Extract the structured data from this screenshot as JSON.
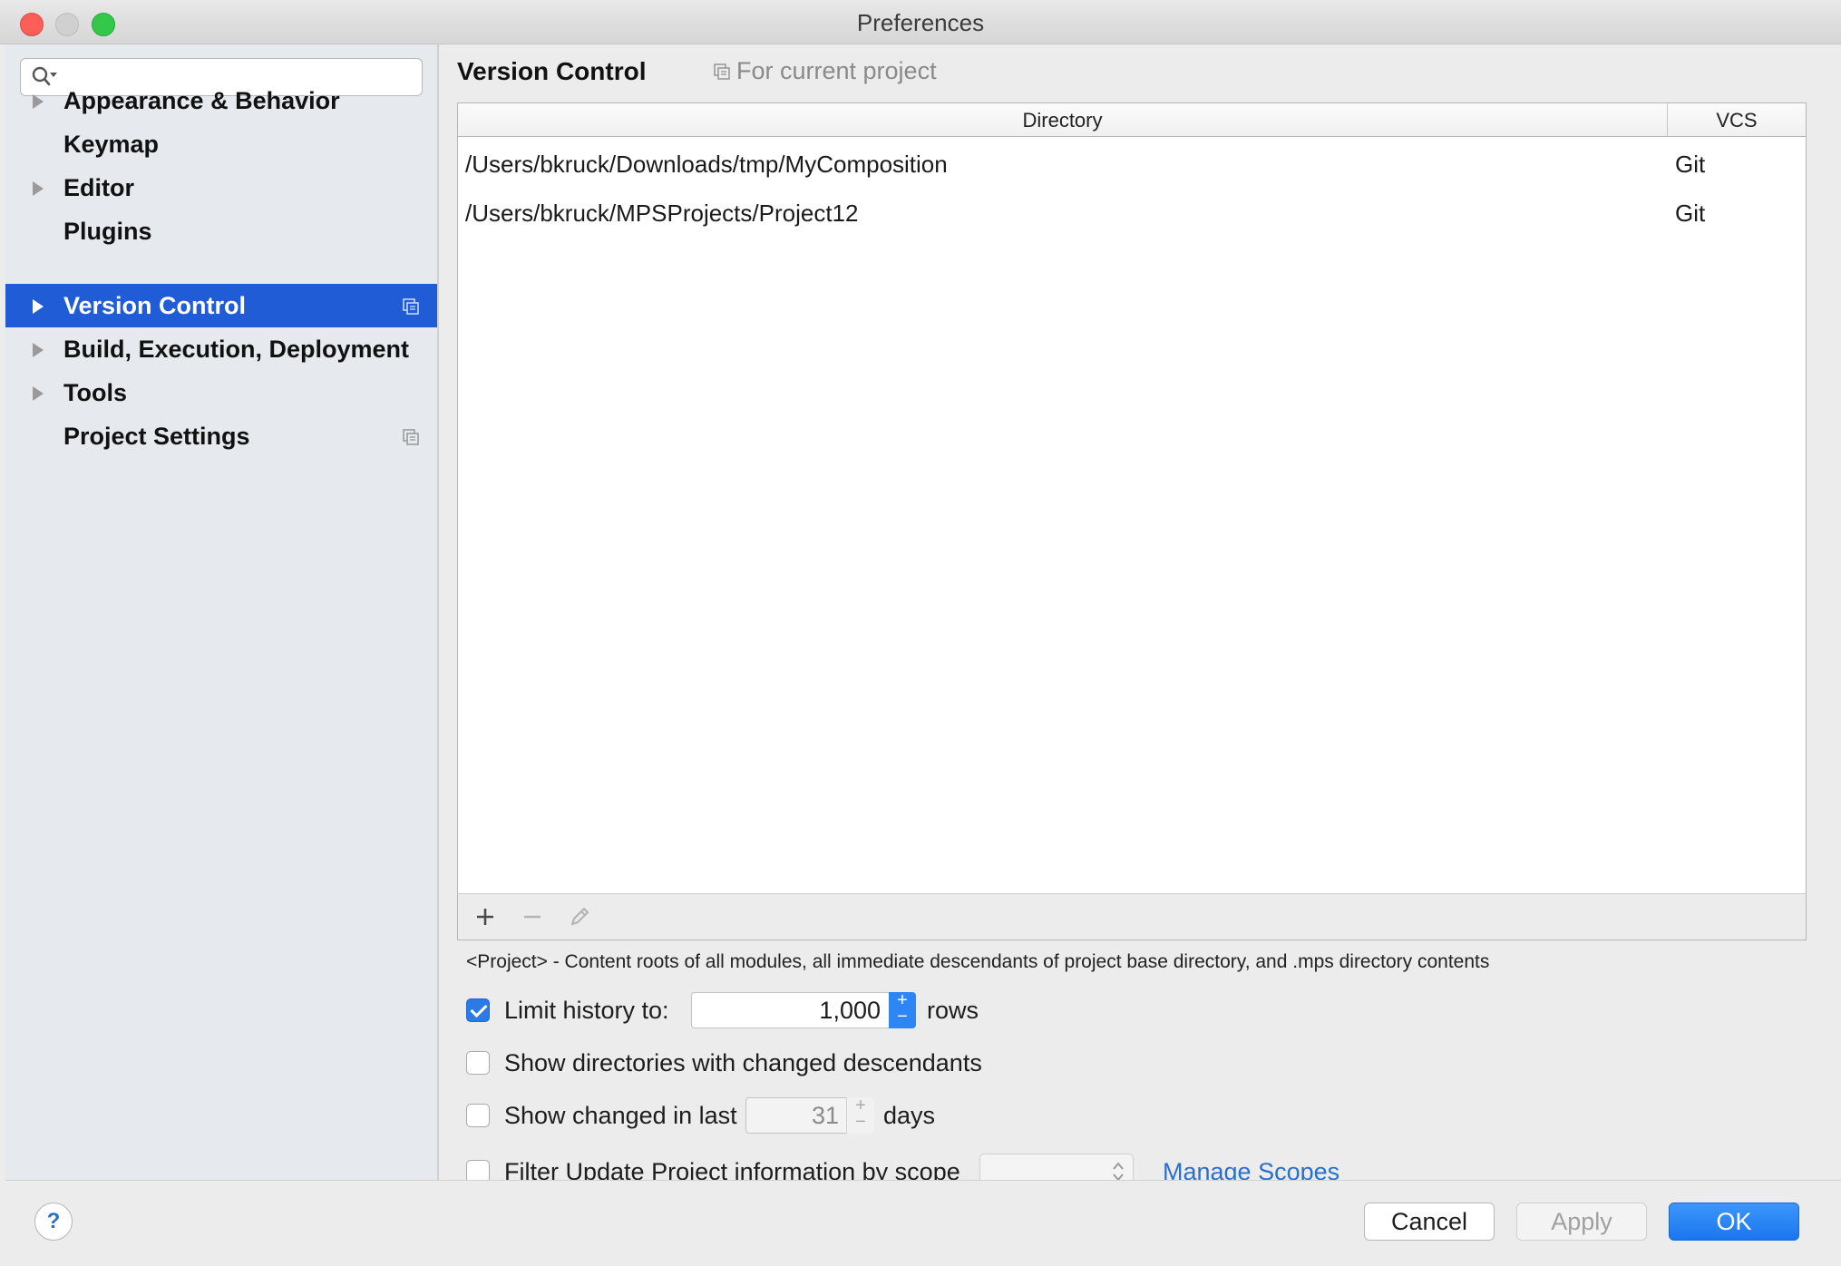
{
  "window": {
    "title": "Preferences"
  },
  "sidebar": {
    "search": {
      "value": "",
      "placeholder": ""
    },
    "items": [
      {
        "label": "Appearance & Behavior",
        "expandable": true,
        "selected": false,
        "project_icon": false
      },
      {
        "label": "Keymap",
        "expandable": false,
        "selected": false,
        "project_icon": false
      },
      {
        "label": "Editor",
        "expandable": true,
        "selected": false,
        "project_icon": false
      },
      {
        "label": "Plugins",
        "expandable": false,
        "selected": false,
        "project_icon": false
      },
      {
        "label": "Version Control",
        "expandable": true,
        "selected": true,
        "project_icon": true
      },
      {
        "label": "Build, Execution, Deployment",
        "expandable": true,
        "selected": false,
        "project_icon": false
      },
      {
        "label": "Tools",
        "expandable": true,
        "selected": false,
        "project_icon": false
      },
      {
        "label": "Project Settings",
        "expandable": false,
        "selected": false,
        "project_icon": true
      }
    ]
  },
  "main": {
    "title": "Version Control",
    "scope_hint": "For current project",
    "table": {
      "columns": {
        "directory": "Directory",
        "vcs": "VCS"
      },
      "rows": [
        {
          "directory": "/Users/bkruck/Downloads/tmp/MyComposition",
          "vcs": "Git"
        },
        {
          "directory": "/Users/bkruck/MPSProjects/Project12",
          "vcs": "Git"
        }
      ]
    },
    "toolbar": {
      "add": "+",
      "remove": "−"
    },
    "note": "<Project> - Content roots of all modules, all immediate descendants of project base directory, and .mps directory contents",
    "options": {
      "limit_history": {
        "label": "Limit history to:",
        "checked": true,
        "value": "1,000",
        "suffix": "rows"
      },
      "show_dirs": {
        "label": "Show directories with changed descendants",
        "checked": false
      },
      "show_changed": {
        "label": "Show changed in last",
        "checked": false,
        "value": "31",
        "suffix": "days"
      },
      "filter_update": {
        "label": "Filter Update Project information by scope",
        "checked": false,
        "scope_value": ""
      },
      "manage_scopes": "Manage Scopes"
    }
  },
  "footer": {
    "help": "?",
    "cancel": "Cancel",
    "apply": "Apply",
    "ok": "OK"
  },
  "colors": {
    "selection": "#1f5cd6",
    "accent": "#2d86f3",
    "link": "#2a6fc9"
  }
}
